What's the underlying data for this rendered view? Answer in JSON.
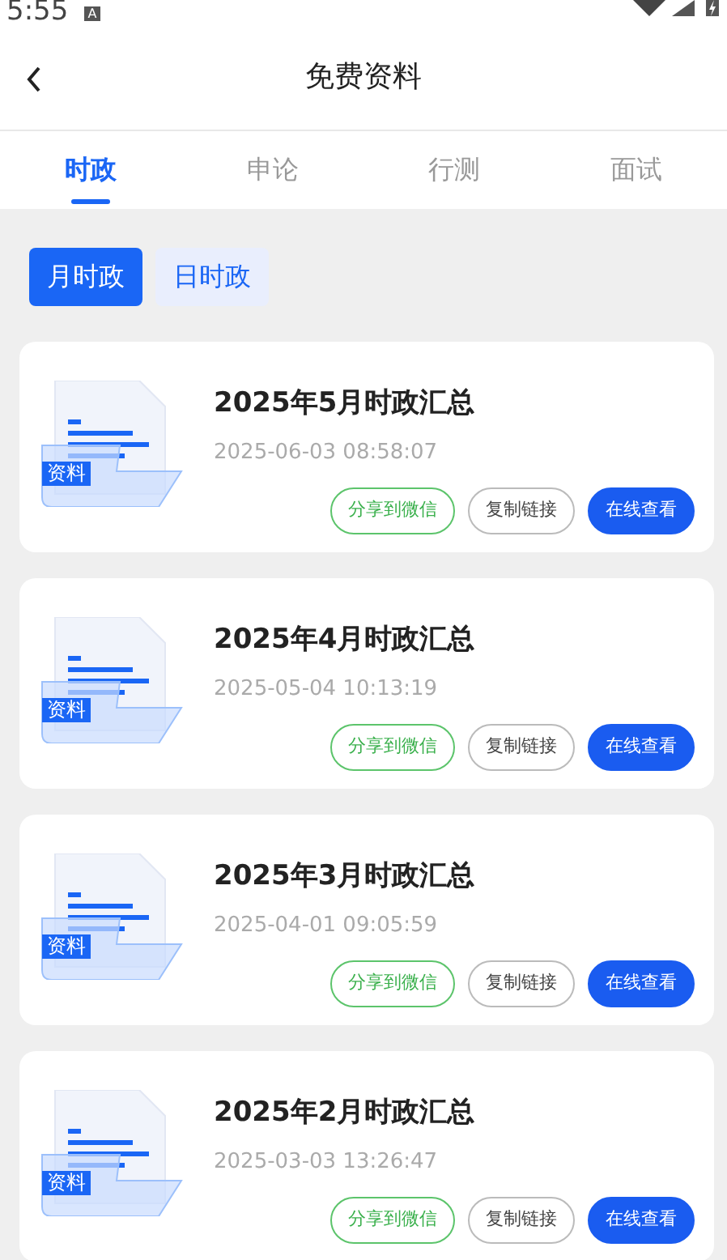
{
  "status_bar": {
    "time": "5:55",
    "notice": "A"
  },
  "header": {
    "title": "免费资料"
  },
  "tabs": [
    {
      "label": "时政",
      "selected": true
    },
    {
      "label": "申论",
      "selected": false
    },
    {
      "label": "行测",
      "selected": false
    },
    {
      "label": "面试",
      "selected": false
    }
  ],
  "subtabs": [
    {
      "label": "月时政",
      "selected": true
    },
    {
      "label": "日时政",
      "selected": false
    }
  ],
  "items": [
    {
      "title": "2025年5月时政汇总",
      "date": "2025-06-03 08:58:07",
      "tag": "资料",
      "buttons": [
        "分享到微信",
        "复制链接",
        "在线查看"
      ]
    },
    {
      "title": "2025年4月时政汇总",
      "date": "2025-05-04 10:13:19",
      "tag": "资料",
      "buttons": [
        "分享到微信",
        "复制链接",
        "在线查看"
      ]
    },
    {
      "title": "2025年3月时政汇总",
      "date": "2025-04-01 09:05:59",
      "tag": "资料",
      "buttons": [
        "分享到微信",
        "复制链接",
        "在线查看"
      ]
    },
    {
      "title": "2025年2月时政汇总",
      "date": "2025-03-03 13:26:47",
      "tag": "资料",
      "buttons": [
        "分享到微信",
        "复制链接",
        "在线查看"
      ]
    }
  ]
}
